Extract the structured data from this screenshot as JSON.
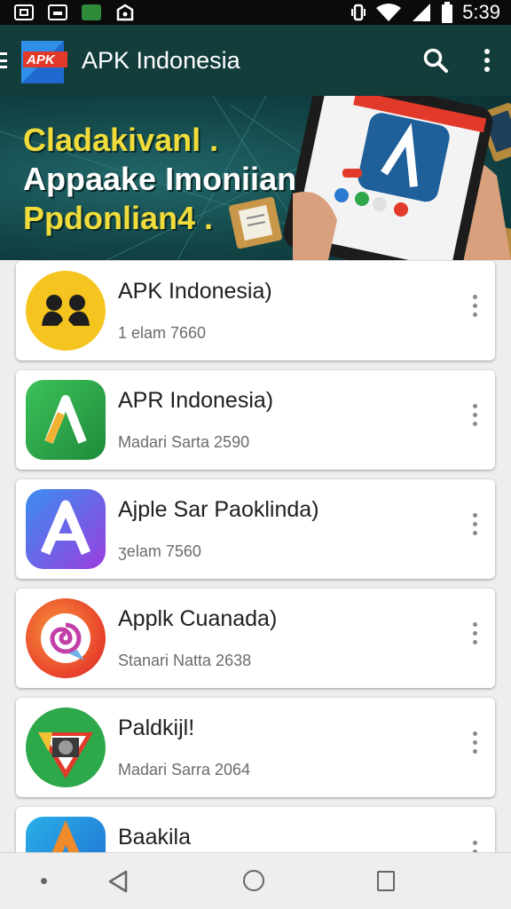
{
  "status_bar": {
    "time": "5:39",
    "icons": [
      "image-icon",
      "keyboard-icon",
      "app-notification-icon",
      "bag-icon",
      "vibrate-icon",
      "wifi-icon",
      "signal-icon",
      "battery-icon"
    ]
  },
  "app_bar": {
    "logo_text": "APK",
    "title": "APK Indonesia",
    "icons": [
      "menu-icon",
      "search-icon",
      "more-vert-icon"
    ]
  },
  "banner": {
    "line1": "Cladakivanl .",
    "line2": "Appaake Imoniian",
    "line3": "Ppdonlian4 ."
  },
  "apps": [
    {
      "title": "APK Indonesia)",
      "subtitle": "1 elam 7660",
      "icon": "app-icon-yellow-people",
      "color": "#f6c41e"
    },
    {
      "title": "APR Indonesia)",
      "subtitle": "Madari Sarta 2590",
      "icon": "app-icon-green-a",
      "color": "#2fa84a"
    },
    {
      "title": "Ajple Sar Paoklinda)",
      "subtitle": "ʒelam 7560",
      "icon": "app-icon-purple-a",
      "color": "#7a4de0"
    },
    {
      "title": "Applk Cuanada)",
      "subtitle": "Stanari Natta 2638",
      "icon": "app-icon-orange-swirl",
      "color": "#ea5a2a"
    },
    {
      "title": "Paldkijl!",
      "subtitle": "Madari Sarra 2064",
      "icon": "app-icon-green-chrome",
      "color": "#2da84a"
    },
    {
      "title": "Baakila",
      "subtitle": "",
      "icon": "app-icon-blue-a",
      "color": "#2a8fd8"
    }
  ],
  "nav_bar": {
    "icons": [
      "nav-dot-icon",
      "back-icon",
      "home-icon",
      "recents-icon"
    ]
  }
}
